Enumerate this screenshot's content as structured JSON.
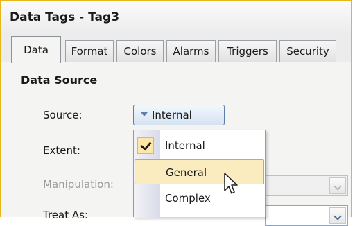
{
  "window": {
    "title": "Data Tags - Tag3"
  },
  "tabs": [
    {
      "label": "Data"
    },
    {
      "label": "Format"
    },
    {
      "label": "Colors"
    },
    {
      "label": "Alarms"
    },
    {
      "label": "Triggers"
    },
    {
      "label": "Security"
    }
  ],
  "active_tab": "Data",
  "data_source": {
    "title": "Data Source",
    "source_label": "Source:",
    "source_value": "Internal",
    "extent_label": "Extent:",
    "manipulation_label": "Manipulation:",
    "treat_as_label": "Treat As:"
  },
  "source_menu": {
    "items": [
      {
        "label": "Internal",
        "checked": true
      },
      {
        "label": "General",
        "hovered": true
      },
      {
        "label": "Complex"
      }
    ]
  },
  "colors": {
    "frame_accent": "#e6b61b",
    "hover_fill": "#fbecc0",
    "hover_border": "#d9a64a",
    "check_fill": "#fde7a8"
  },
  "icons": {
    "dropdown": "chevron-down-icon",
    "check": "check-icon",
    "cursor": "mouse-pointer-icon"
  }
}
